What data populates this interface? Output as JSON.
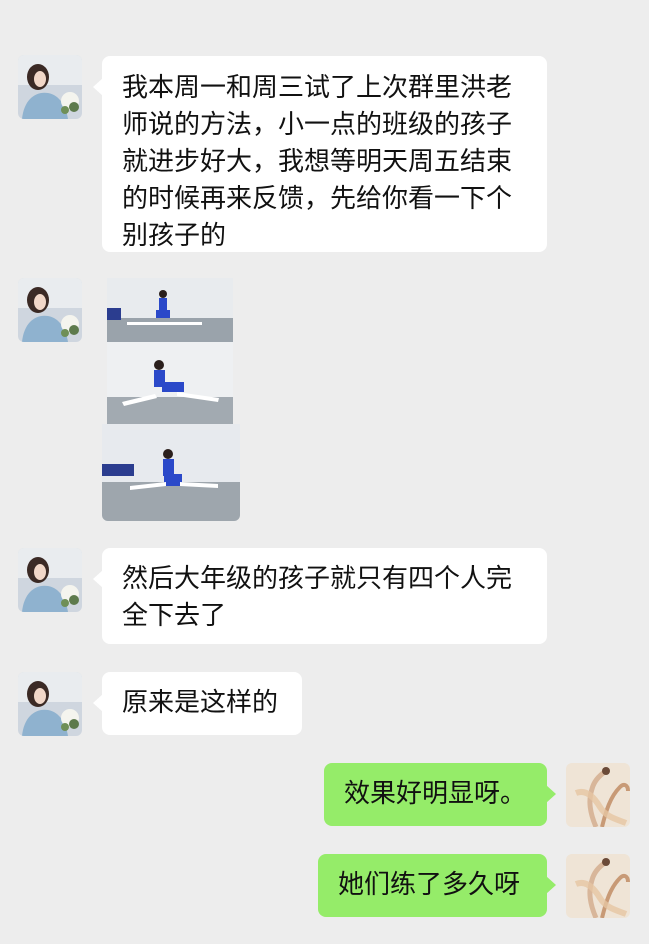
{
  "messages": [
    {
      "sender": "other",
      "type": "text",
      "lines": [
        "我本周一和周三试了上次群里洪老",
        "师说的方法，小一点的班级的孩子",
        "就进步好大，我想等明天周五结束",
        "的时候再来反馈，先给你看一下个",
        "别孩子的"
      ]
    },
    {
      "sender": "other",
      "type": "images",
      "count": 3
    },
    {
      "sender": "other",
      "type": "text",
      "lines": [
        "然后大年级的孩子就只有四个人完",
        "全下去了"
      ]
    },
    {
      "sender": "other",
      "type": "text",
      "lines": [
        "原来是这样的"
      ]
    },
    {
      "sender": "self",
      "type": "text",
      "lines": [
        "效果好明显呀。"
      ]
    },
    {
      "sender": "self",
      "type": "text",
      "lines": [
        "她们练了多久呀"
      ]
    }
  ],
  "colors": {
    "background": "#ededed",
    "incoming_bubble": "#ffffff",
    "outgoing_bubble": "#95ec69"
  }
}
